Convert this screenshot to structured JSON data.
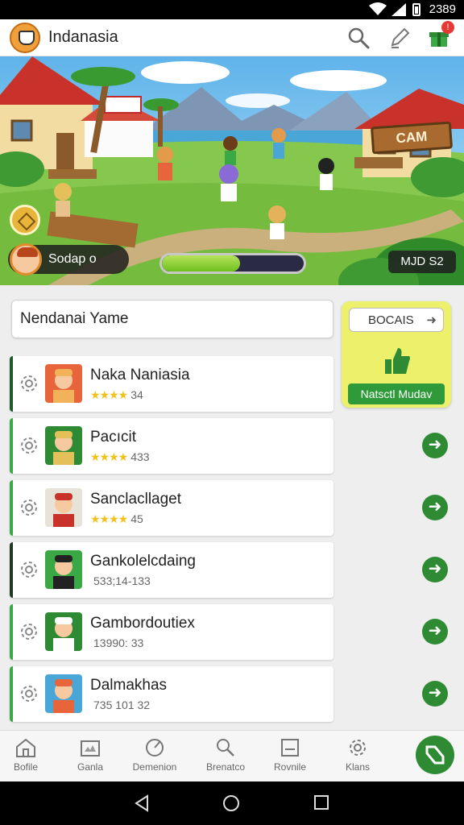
{
  "status_bar": {
    "time": "2389"
  },
  "app_bar": {
    "title": "Indanasia",
    "icons": [
      "search-icon",
      "edit-icon",
      "gift-icon"
    ],
    "badge": "!"
  },
  "hero": {
    "sign": "CAM",
    "player_name": "Sodap o",
    "xp_progress": 0.55,
    "score": "MJD S2"
  },
  "search": {
    "value": "Nendanai Yame"
  },
  "promo": {
    "tag": "BOCAIS",
    "cta": "Natsctl Mudav",
    "color": "#ecf06a"
  },
  "games": [
    {
      "name": "Naka Naniasia",
      "rating": "★★★★",
      "meta": "34",
      "accent": "#1e5a2a"
    },
    {
      "name": "Pacıcit",
      "rating": "★★★★",
      "meta": "433",
      "accent": "#3aa845"
    },
    {
      "name": "Sanclacllaget",
      "rating": "★★★★",
      "meta": "45",
      "accent": "#3aa845"
    },
    {
      "name": "Gankolelcdaing",
      "rating": "",
      "meta": "533;14-133",
      "accent": "#1e3a22"
    },
    {
      "name": "Gambordoutiex",
      "rating": "",
      "meta": "13990: 33",
      "accent": "#3aa845"
    },
    {
      "name": "Dalmakhas",
      "rating": "",
      "meta": "735 101 32",
      "accent": "#3aa845"
    }
  ],
  "bottom_nav": [
    {
      "label": "Bofile",
      "icon": "home-icon"
    },
    {
      "label": "Ganla",
      "icon": "games-icon"
    },
    {
      "label": "Demenion",
      "icon": "timer-icon"
    },
    {
      "label": "Brenatco",
      "icon": "search-person-icon"
    },
    {
      "label": "Rovnile",
      "icon": "document-icon"
    },
    {
      "label": "Klans",
      "icon": "settings-icon"
    }
  ],
  "accent_color": "#2e8b34"
}
